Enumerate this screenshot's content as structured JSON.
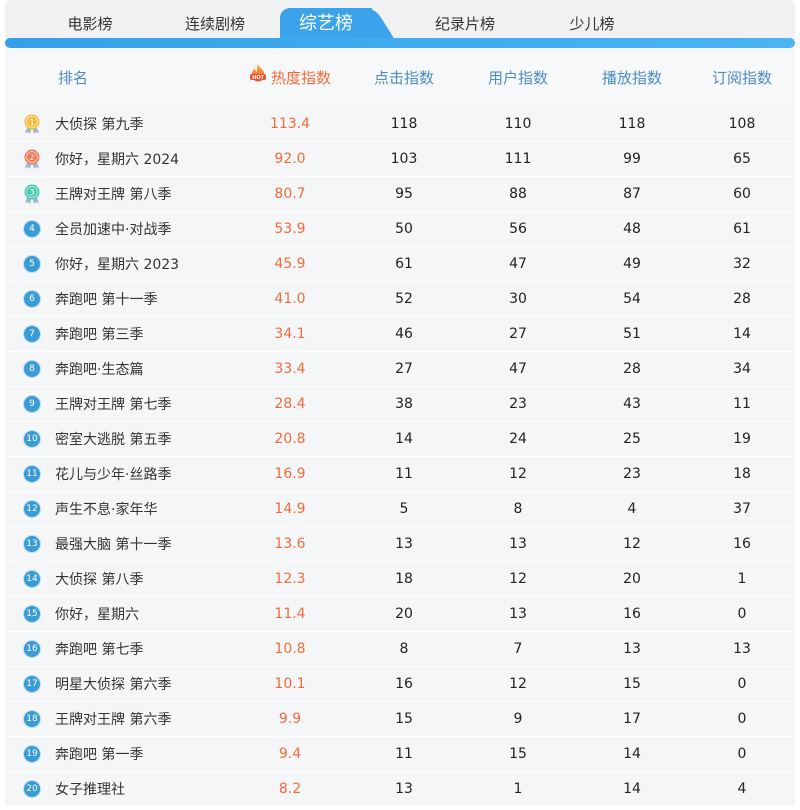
{
  "tabs": [
    {
      "label": "电影榜",
      "active": false
    },
    {
      "label": "连续剧榜",
      "active": false
    },
    {
      "label": "综艺榜",
      "active": true
    },
    {
      "label": "纪录片榜",
      "active": false
    },
    {
      "label": "少儿榜",
      "active": false
    }
  ],
  "table": {
    "headers": {
      "rank": "排名",
      "hot": "热度指数",
      "click": "点击指数",
      "user": "用户指数",
      "play": "播放指数",
      "subscribe": "订阅指数"
    },
    "hot_badge": "HOT",
    "rows": [
      {
        "rank": "1",
        "name": "大侦探 第九季",
        "hot": "113.4",
        "click": "118",
        "user": "110",
        "play": "118",
        "subscribe": "108"
      },
      {
        "rank": "2",
        "name": "你好，星期六 2024",
        "hot": "92.0",
        "click": "103",
        "user": "111",
        "play": "99",
        "subscribe": "65"
      },
      {
        "rank": "3",
        "name": "王牌对王牌 第八季",
        "hot": "80.7",
        "click": "95",
        "user": "88",
        "play": "87",
        "subscribe": "60"
      },
      {
        "rank": "4",
        "name": "全员加速中·对战季",
        "hot": "53.9",
        "click": "50",
        "user": "56",
        "play": "48",
        "subscribe": "61"
      },
      {
        "rank": "5",
        "name": "你好，星期六 2023",
        "hot": "45.9",
        "click": "61",
        "user": "47",
        "play": "49",
        "subscribe": "32"
      },
      {
        "rank": "6",
        "name": "奔跑吧 第十一季",
        "hot": "41.0",
        "click": "52",
        "user": "30",
        "play": "54",
        "subscribe": "28"
      },
      {
        "rank": "7",
        "name": "奔跑吧 第三季",
        "hot": "34.1",
        "click": "46",
        "user": "27",
        "play": "51",
        "subscribe": "14"
      },
      {
        "rank": "8",
        "name": "奔跑吧·生态篇",
        "hot": "33.4",
        "click": "27",
        "user": "47",
        "play": "28",
        "subscribe": "34"
      },
      {
        "rank": "9",
        "name": "王牌对王牌 第七季",
        "hot": "28.4",
        "click": "38",
        "user": "23",
        "play": "43",
        "subscribe": "11"
      },
      {
        "rank": "10",
        "name": "密室大逃脱 第五季",
        "hot": "20.8",
        "click": "14",
        "user": "24",
        "play": "25",
        "subscribe": "19"
      },
      {
        "rank": "11",
        "name": "花儿与少年·丝路季",
        "hot": "16.9",
        "click": "11",
        "user": "12",
        "play": "23",
        "subscribe": "18"
      },
      {
        "rank": "12",
        "name": "声生不息·家年华",
        "hot": "14.9",
        "click": "5",
        "user": "8",
        "play": "4",
        "subscribe": "37"
      },
      {
        "rank": "13",
        "name": "最强大脑 第十一季",
        "hot": "13.6",
        "click": "13",
        "user": "13",
        "play": "12",
        "subscribe": "16"
      },
      {
        "rank": "14",
        "name": "大侦探 第八季",
        "hot": "12.3",
        "click": "18",
        "user": "12",
        "play": "20",
        "subscribe": "1"
      },
      {
        "rank": "15",
        "name": "你好，星期六",
        "hot": "11.4",
        "click": "20",
        "user": "13",
        "play": "16",
        "subscribe": "0"
      },
      {
        "rank": "16",
        "name": "奔跑吧 第七季",
        "hot": "10.8",
        "click": "8",
        "user": "7",
        "play": "13",
        "subscribe": "13"
      },
      {
        "rank": "17",
        "name": "明星大侦探 第六季",
        "hot": "10.1",
        "click": "16",
        "user": "12",
        "play": "15",
        "subscribe": "0"
      },
      {
        "rank": "18",
        "name": "王牌对王牌 第六季",
        "hot": "9.9",
        "click": "15",
        "user": "9",
        "play": "17",
        "subscribe": "0"
      },
      {
        "rank": "19",
        "name": "奔跑吧 第一季",
        "hot": "9.4",
        "click": "11",
        "user": "15",
        "play": "14",
        "subscribe": "0"
      },
      {
        "rank": "20",
        "name": "女子推理社",
        "hot": "8.2",
        "click": "13",
        "user": "1",
        "play": "14",
        "subscribe": "4"
      }
    ]
  },
  "icons": {
    "hot": "hot-flame-icon",
    "top3": "medal-icon",
    "rank": "rank-circle-icon"
  },
  "colors": {
    "accent": "#3ba3ec",
    "hot": "#f26b3a",
    "header_text": "#4b8cc5",
    "rank_circle": "#3a9bd5",
    "ribbon": "#9fb4d0",
    "medals": [
      "#f5bd3b",
      "#f2785c",
      "#4bc9ac"
    ]
  }
}
